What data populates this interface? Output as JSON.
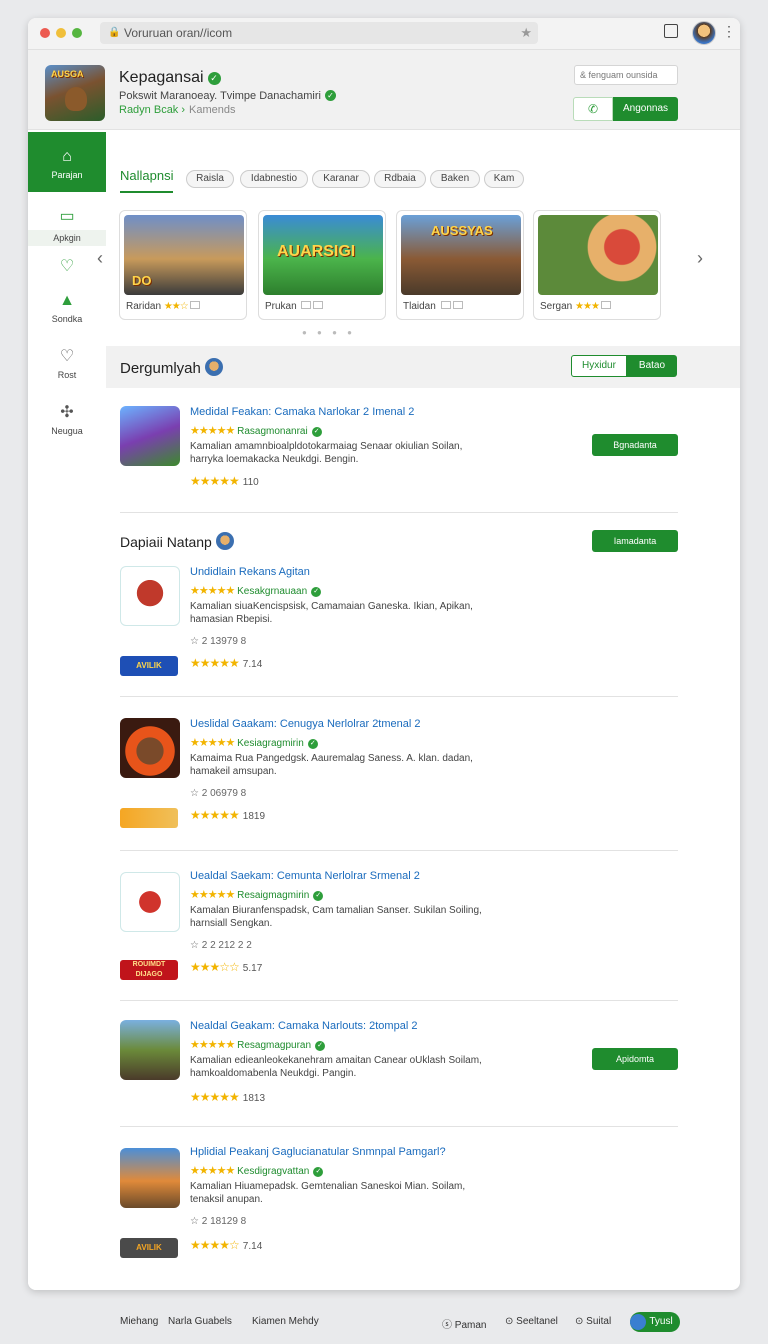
{
  "browser": {
    "address": "Voruruan oran//icom"
  },
  "header": {
    "app_title": "Kepagansai",
    "app_icon_text": "AUSGA",
    "subtitle": "Pokswit Maranoeay. Tvimpe Danachamiri",
    "developer": "Radyn Bcak",
    "developer_extra": "Kamends",
    "search_placeholder": "& fenguam ounsida",
    "install_label": "Angonnas"
  },
  "sidebar": {
    "items": [
      {
        "label": "Parajan",
        "icon": "home-icon"
      },
      {
        "label": "Apkgin",
        "icon": "book-icon"
      },
      {
        "label": "",
        "icon": "leaf-icon"
      },
      {
        "label": "Sondka",
        "icon": "tree-icon"
      },
      {
        "label": "Rost",
        "icon": "heart-icon"
      },
      {
        "label": "Neugua",
        "icon": "puzzle-icon"
      }
    ]
  },
  "tabs": {
    "active": "Nallapnsi",
    "chips": [
      "Raisla",
      "Idabnestio",
      "Karanar",
      "Rdbaia",
      "Baken",
      "Kam"
    ]
  },
  "carousel": {
    "cards": [
      {
        "caption": "Raridan",
        "thumb_text": "DO",
        "rating": 2.5
      },
      {
        "caption": "Prukan",
        "thumb_text": "AUARSIGI",
        "rating": 0
      },
      {
        "caption": "Tlaidan",
        "thumb_text": "AUSSYAS",
        "rating": 0
      },
      {
        "caption": "Sergan",
        "thumb_text": "",
        "rating": 3
      }
    ]
  },
  "section": {
    "title": "Dergumlyah",
    "toggle_left": "Hyxidur",
    "toggle_right": "Batao"
  },
  "featured": {
    "title": "Medidal Feakan: Camaka Narlokar 2 Imenal 2",
    "tag": "Rasagmonanrai",
    "desc": "Kamalian amamnbioalpldotokarmaiag Senaar okiulian Soilan, harryka loemakacka Neukdgi. Bengin.",
    "rating_text": "110",
    "action": "Bgnadanta"
  },
  "subsection": {
    "title": "Dapiaii Natanp",
    "action": "Iamadanta"
  },
  "apps": [
    {
      "title": "Undidlain Rekans Agitan",
      "tag": "Kesakgrnauaan",
      "desc": "Kamalian siuaKencispsisk, Camamaian Ganeska. Ikian, Apikan, hamasian Rbepisi.",
      "meta": "☆ 2 13979 8",
      "badge": "AVILIK",
      "rating_text": "7.14",
      "action": ""
    },
    {
      "title": "Ueslidal Gaakam: Cenugya Nerlolrar 2tmenal 2",
      "tag": "Kesiagragmirin",
      "desc": "Kamaima Rua Pangedgsk. Aauremalag Saness. A. klan. dadan, hamakeil amsupan.",
      "meta": "☆ 2 06979 8",
      "badge": "",
      "rating_text": "1819",
      "action": ""
    },
    {
      "title": "Uealdal Saekam: Cemunta Nerlolrar Srmenal 2",
      "tag": "Resaigmagmirin",
      "desc": "Kamalan Biuranfenspadsk, Cam tamalian Sanser. Sukilan Soiling, harnsiall Sengkan.",
      "meta": "☆ 2 2 212 2 2",
      "badge": "ROUIMDT DIJAGO",
      "rating_text": "5.17",
      "action": ""
    },
    {
      "title": "Nealdal Geakam: Camaka Narlouts: 2tompal 2",
      "tag": "Resagmagpuran",
      "desc": "Kamalian edieanleokekanehram amaitan Canear oUklash Soilam, hamkoaldomabenla Neukdgi. Pangin.",
      "meta": "",
      "badge": "",
      "rating_text": "1813",
      "action": "Apidomta"
    },
    {
      "title": "Hplidial Peakanj Gaglucianatular Snmnpal Pamgarl?",
      "tag": "Kesdigragvattan",
      "desc": "Kamalian Hiuamepadsk. Gemtenalian Saneskoi Mian. Soilam, tenaksil anupan.",
      "meta": "☆ 2 18129 8",
      "badge": "AVILIK",
      "rating_text": "7.14",
      "action": ""
    }
  ],
  "footer": {
    "links": [
      "Miehang",
      "Narla Guabels",
      "Kiamen Mehdy"
    ],
    "right_links": [
      "Paman",
      "Seeltanel",
      "Suital"
    ],
    "button": "Tyusl"
  },
  "colors": {
    "accent": "#1f8c2e",
    "link": "#1a6bbd",
    "star": "#f2b400"
  }
}
